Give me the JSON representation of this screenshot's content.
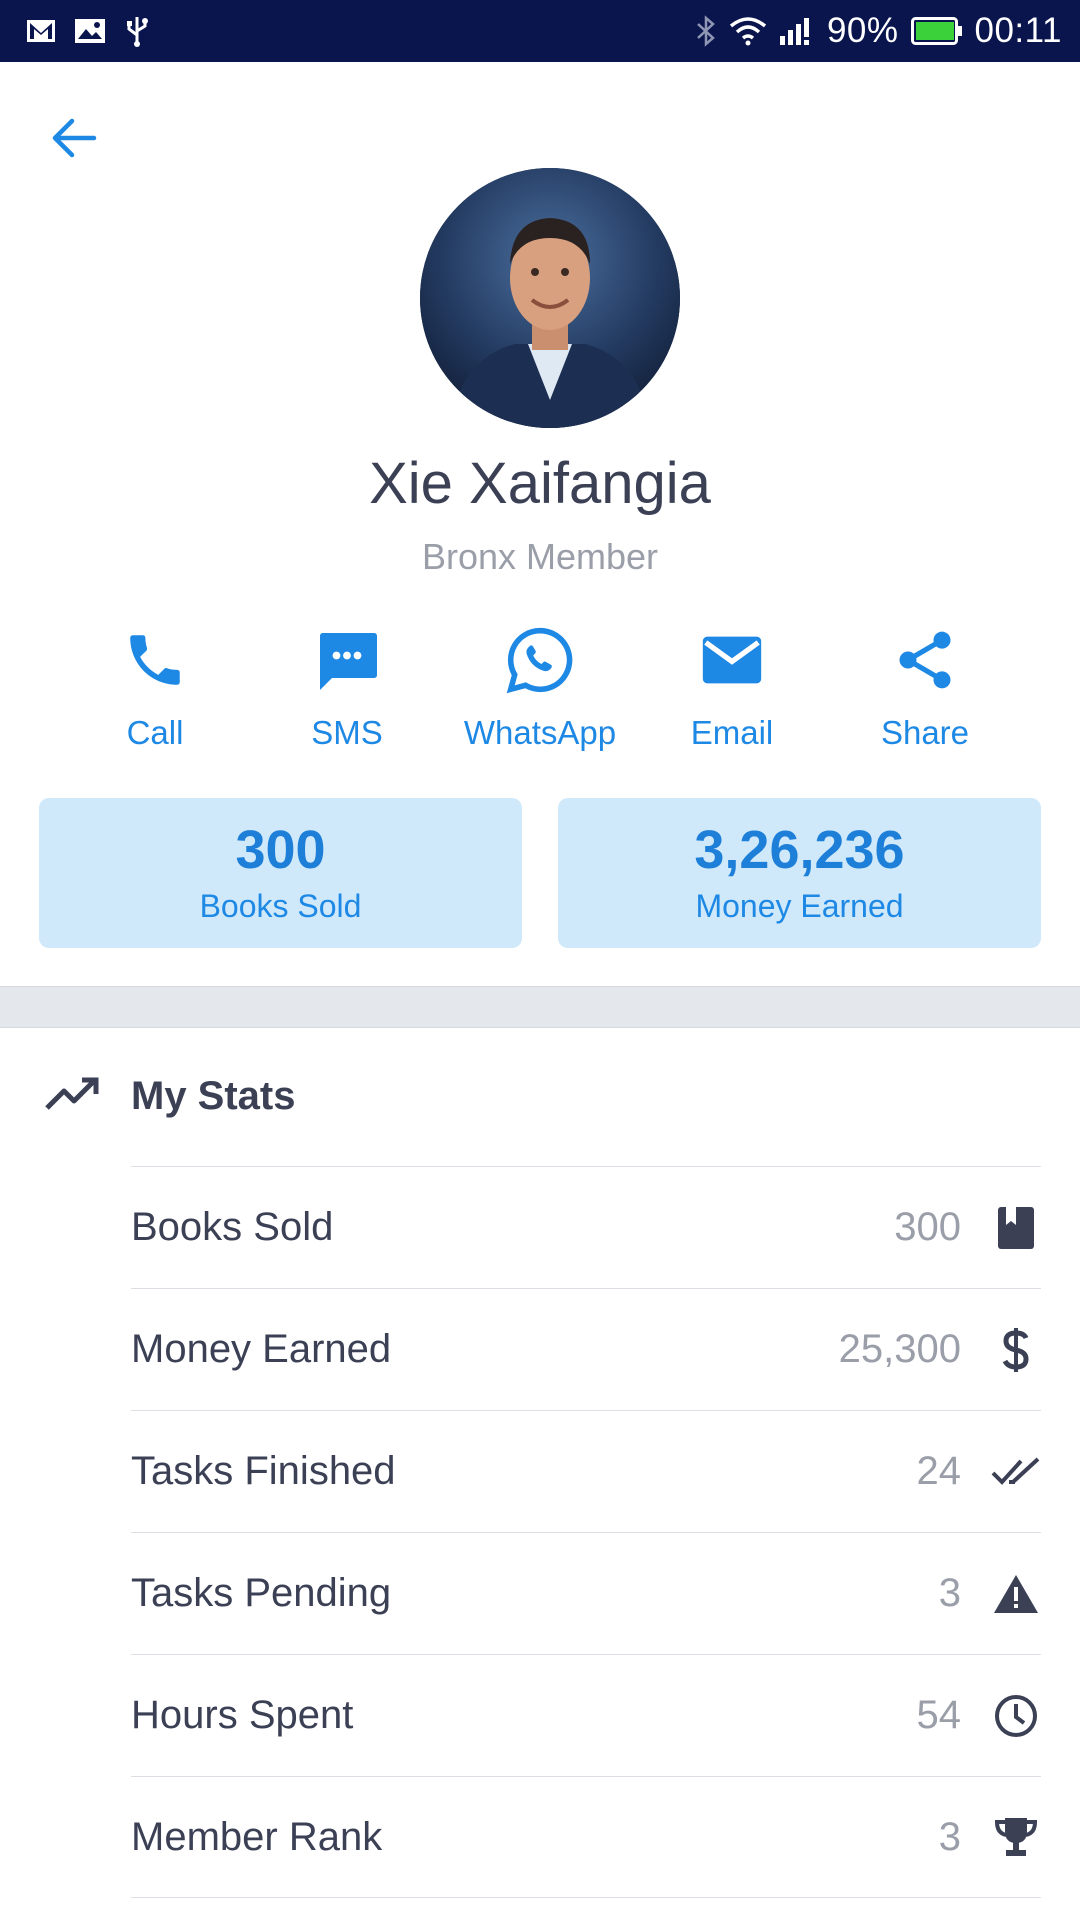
{
  "status_bar": {
    "battery": "90%",
    "time": "00:11"
  },
  "profile": {
    "name": "Xie Xaifangia",
    "subtitle": "Bronx Member"
  },
  "actions": [
    {
      "label": "Call",
      "icon": "phone-icon"
    },
    {
      "label": "SMS",
      "icon": "message-icon"
    },
    {
      "label": "WhatsApp",
      "icon": "whatsapp-icon"
    },
    {
      "label": "Email",
      "icon": "email-icon"
    },
    {
      "label": "Share",
      "icon": "share-icon"
    }
  ],
  "summary": [
    {
      "value": "300",
      "caption": "Books Sold"
    },
    {
      "value": "3,26,236",
      "caption": "Money Earned"
    }
  ],
  "stats": {
    "title": "My Stats",
    "rows": [
      {
        "label": "Books Sold",
        "value": "300",
        "icon": "book-icon"
      },
      {
        "label": "Money Earned",
        "value": "25,300",
        "icon": "dollar-icon"
      },
      {
        "label": "Tasks Finished",
        "value": "24",
        "icon": "double-check-icon"
      },
      {
        "label": "Tasks Pending",
        "value": "3",
        "icon": "warning-icon"
      },
      {
        "label": "Hours Spent",
        "value": "54",
        "icon": "clock-icon"
      },
      {
        "label": "Member Rank",
        "value": "3",
        "icon": "trophy-icon"
      }
    ]
  },
  "colors": {
    "accent": "#1e88e5",
    "status_bar": "#0a154e",
    "card_bg": "#cfe9fb",
    "text_dark": "#3b4055",
    "text_muted": "#9a9ea8"
  }
}
